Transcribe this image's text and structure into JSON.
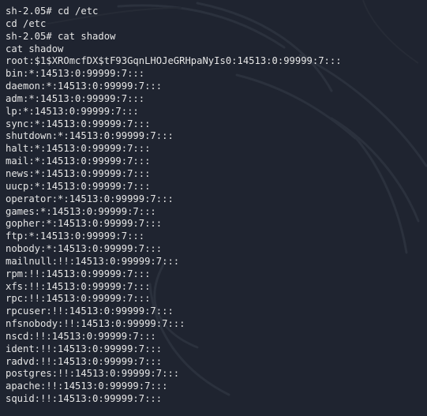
{
  "terminal": {
    "lines": [
      "sh-2.05# cd /etc",
      "cd /etc",
      "sh-2.05# cat shadow",
      "cat shadow",
      "root:$1$XROmcfDX$tF93GqnLHOJeGRHpaNyIs0:14513:0:99999:7:::",
      "bin:*:14513:0:99999:7:::",
      "daemon:*:14513:0:99999:7:::",
      "adm:*:14513:0:99999:7:::",
      "lp:*:14513:0:99999:7:::",
      "sync:*:14513:0:99999:7:::",
      "shutdown:*:14513:0:99999:7:::",
      "halt:*:14513:0:99999:7:::",
      "mail:*:14513:0:99999:7:::",
      "news:*:14513:0:99999:7:::",
      "uucp:*:14513:0:99999:7:::",
      "operator:*:14513:0:99999:7:::",
      "games:*:14513:0:99999:7:::",
      "gopher:*:14513:0:99999:7:::",
      "ftp:*:14513:0:99999:7:::",
      "nobody:*:14513:0:99999:7:::",
      "mailnull:!!:14513:0:99999:7:::",
      "rpm:!!:14513:0:99999:7:::",
      "xfs:!!:14513:0:99999:7:::",
      "rpc:!!:14513:0:99999:7:::",
      "rpcuser:!!:14513:0:99999:7:::",
      "nfsnobody:!!:14513:0:99999:7:::",
      "nscd:!!:14513:0:99999:7:::",
      "ident:!!:14513:0:99999:7:::",
      "radvd:!!:14513:0:99999:7:::",
      "postgres:!!:14513:0:99999:7:::",
      "apache:!!:14513:0:99999:7:::",
      "squid:!!:14513:0:99999:7:::"
    ]
  },
  "colors": {
    "background": "#1f2430",
    "text": "#e6e6e6",
    "wallpaper_art": "#2a303c"
  }
}
